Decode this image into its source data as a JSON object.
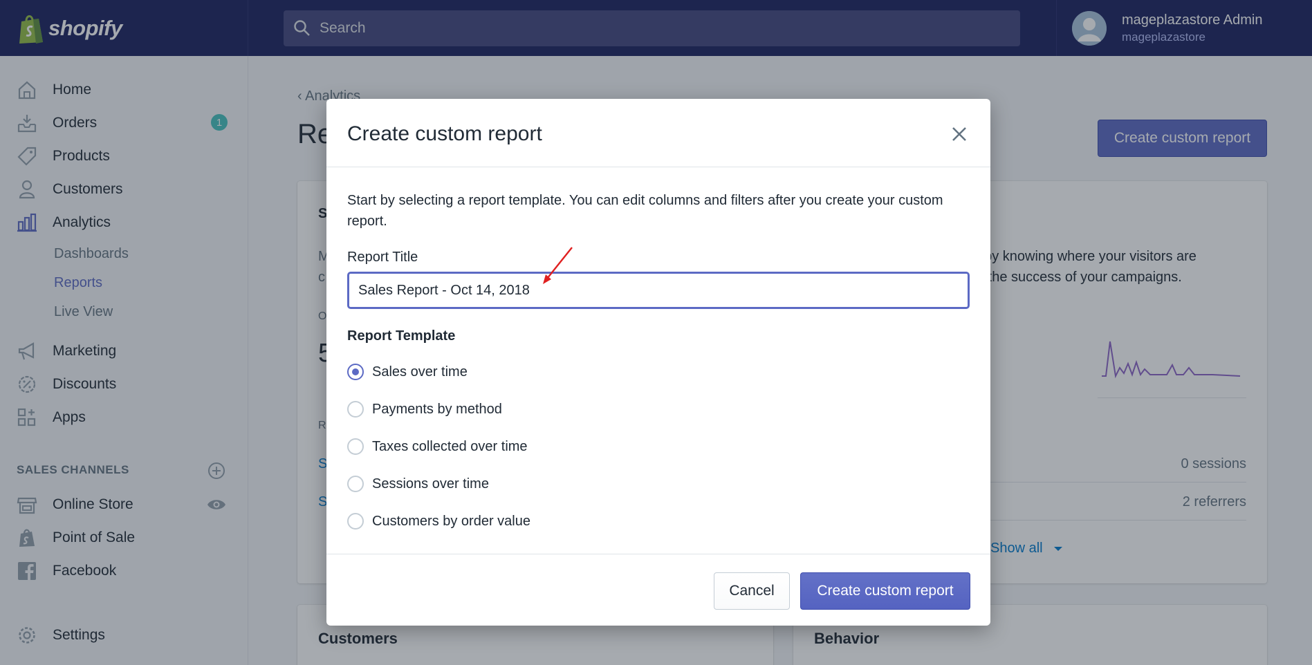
{
  "brand": {
    "name": "shopify"
  },
  "search": {
    "placeholder": "Search"
  },
  "user": {
    "name": "mageplazastore Admin",
    "store": "mageplazastore"
  },
  "sidebar": {
    "items": [
      {
        "label": "Home"
      },
      {
        "label": "Orders",
        "badge": "1"
      },
      {
        "label": "Products"
      },
      {
        "label": "Customers"
      },
      {
        "label": "Analytics"
      },
      {
        "label": "Marketing"
      },
      {
        "label": "Discounts"
      },
      {
        "label": "Apps"
      }
    ],
    "analytics_sub": [
      "Dashboards",
      "Reports",
      "Live View"
    ],
    "sales_channels_title": "SALES CHANNELS",
    "channels": [
      {
        "label": "Online Store"
      },
      {
        "label": "Point of Sale"
      },
      {
        "label": "Facebook"
      }
    ],
    "settings_label": "Settings"
  },
  "page": {
    "breadcrumb": "Analytics",
    "title": "Re",
    "create_button": "Create custom report",
    "card_right_text_1": "t by knowing where your visitors are",
    "card_right_text_2": "g the success of your campaigns.",
    "sessions_value": "0 sessions",
    "referrers_value": "2 referrers",
    "show_all": "Show all",
    "customers_card_title": "Customers",
    "behavior_card_title": "Behavior",
    "left_fragments": [
      "S",
      "M",
      "c",
      "O",
      "5",
      "R",
      "S",
      "S"
    ]
  },
  "modal": {
    "title": "Create custom report",
    "description": "Start by selecting a report template. You can edit columns and filters after you create your custom report.",
    "report_title_label": "Report Title",
    "report_title_value": "Sales Report - Oct 14, 2018",
    "template_label": "Report Template",
    "templates": [
      {
        "label": "Sales over time",
        "selected": true
      },
      {
        "label": "Payments by method",
        "selected": false
      },
      {
        "label": "Taxes collected over time",
        "selected": false
      },
      {
        "label": "Sessions over time",
        "selected": false
      },
      {
        "label": "Customers by order value",
        "selected": false
      }
    ],
    "cancel_label": "Cancel",
    "create_label": "Create custom report"
  },
  "colors": {
    "nav_bg": "#1c2260",
    "accent": "#5c6ac4",
    "badge": "#47c1bf",
    "annotation_arrow": "#e02020"
  }
}
